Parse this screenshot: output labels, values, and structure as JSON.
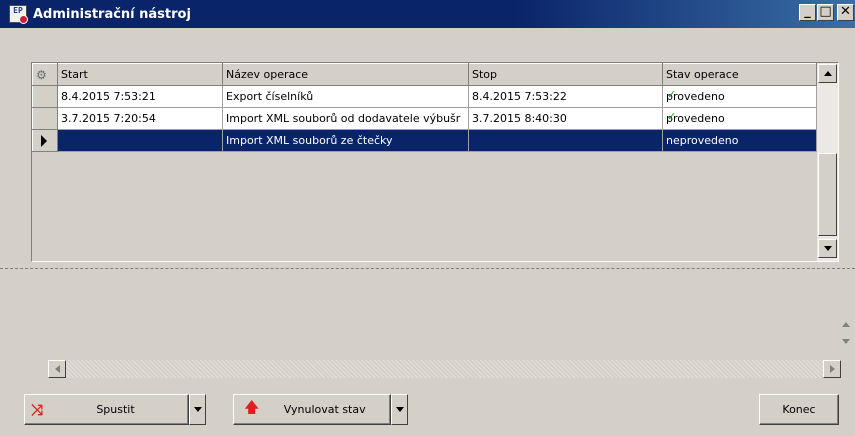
{
  "window": {
    "title": "Administrační nástroj",
    "icon": "app-logo-icon",
    "minimize_label": "_",
    "maximize_label": "□",
    "close_label": "✕"
  },
  "grid": {
    "columns": [
      "Start",
      "Název operace",
      "Stop",
      "Stav operace"
    ],
    "rows": [
      {
        "start": "8.4.2015 7:53:21",
        "name": "Export číselníků",
        "stop": "8.4.2015 7:53:22",
        "status": "provedeno",
        "status_icon": "checkmark-icon"
      },
      {
        "start": "3.7.2015 7:20:54",
        "name": "Import XML souborů od dodavatele výbušr",
        "stop": "3.7.2015 8:40:30",
        "status": "provedeno",
        "status_icon": "checkmark-icon"
      },
      {
        "start": "",
        "name": "Import XML souborů ze čtečky",
        "stop": "",
        "status": "neprovedeno",
        "status_icon": "",
        "selected": true
      }
    ]
  },
  "buttons": {
    "run": "Spustit",
    "reset": "Vynulovat stav",
    "end": "Konec"
  },
  "colors": {
    "selection": "#0a246a",
    "check": "#1fa21f",
    "accent_red": "#e02020"
  }
}
